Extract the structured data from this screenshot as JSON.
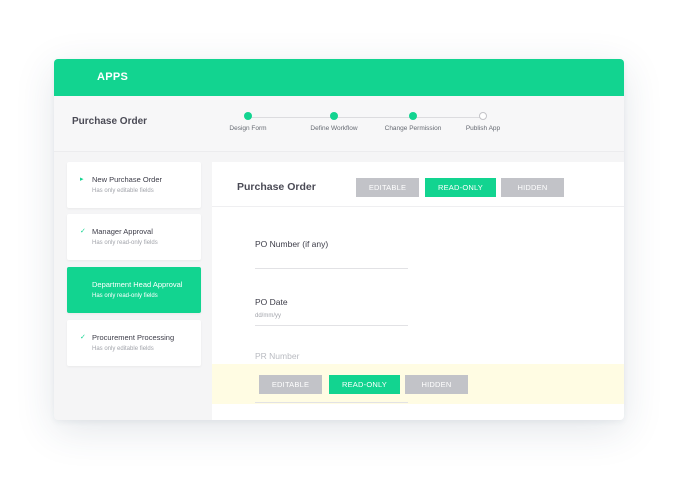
{
  "app": {
    "title": "APPS"
  },
  "header": {
    "title": "Purchase Order"
  },
  "steps": [
    {
      "label": "Design Form",
      "status": "done"
    },
    {
      "label": "Define Workflow",
      "status": "done"
    },
    {
      "label": "Change Permission",
      "status": "done"
    },
    {
      "label": "Publish App",
      "status": "pending"
    }
  ],
  "sidebar": {
    "items": [
      {
        "name": "New Purchase Order",
        "desc": "Has only editable fields",
        "mark": "▸",
        "active": false
      },
      {
        "name": "Manager Approval",
        "desc": "Has only read-only fields",
        "mark": "✓",
        "active": false
      },
      {
        "name": "Department Head Approval",
        "desc": "Has only read-only fields",
        "mark": "",
        "active": true
      },
      {
        "name": "Procurement Processing",
        "desc": "Has only editable fields",
        "mark": "✓",
        "active": false
      }
    ]
  },
  "form": {
    "title": "Purchase Order",
    "permissions": {
      "editable": "EDITABLE",
      "read_only": "READ-ONLY",
      "hidden": "HIDDEN",
      "selected": "READ-ONLY"
    },
    "fields": [
      {
        "label": "PO Number (if any)",
        "hint": ""
      },
      {
        "label": "PO Date",
        "hint": "dd/mm/yy"
      },
      {
        "label": "PR Number",
        "hint": ""
      }
    ]
  },
  "field_toolbar": {
    "editable": "EDITABLE",
    "read_only": "READ-ONLY",
    "hidden": "HIDDEN",
    "selected": "READ-ONLY"
  },
  "colors": {
    "accent": "#12d490",
    "inactive": "#c2c3c8",
    "highlight": "#fffce3"
  }
}
